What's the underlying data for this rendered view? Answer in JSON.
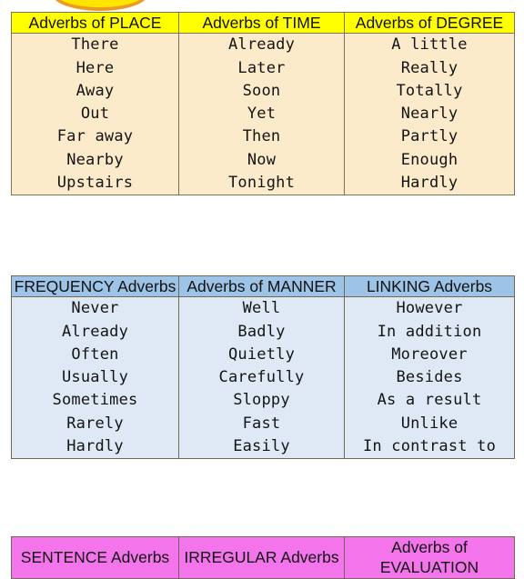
{
  "page": {
    "title": "Adverbs Categories Chart",
    "background_color": "#ffffff"
  },
  "decoration": {
    "badge_name": "partial-oval-badge",
    "fill_color": "#FFE600",
    "border_color": "#ED9B20"
  },
  "tables": [
    {
      "id": "place-time-degree",
      "header_color": "#FFFF00",
      "body_color": "#FCEBCA",
      "columns": [
        {
          "header": "Adverbs of PLACE",
          "items": [
            "There",
            "Here",
            "Away",
            "Out",
            "Far away",
            "Nearby",
            "Upstairs"
          ]
        },
        {
          "header": "Adverbs of TIME",
          "items": [
            "Already",
            "Later",
            "Soon",
            "Yet",
            "Then",
            "Now",
            "Tonight"
          ]
        },
        {
          "header": "Adverbs of DEGREE",
          "items": [
            "A little",
            "Really",
            "Totally",
            "Nearly",
            "Partly",
            "Enough",
            "Hardly"
          ]
        }
      ]
    },
    {
      "id": "frequency-manner-linking",
      "header_color": "#9DC3E6",
      "body_color": "#DEE9F5",
      "columns": [
        {
          "header": "FREQUENCY Adverbs",
          "items": [
            "Never",
            "Already",
            "Often",
            "Usually",
            "Sometimes",
            "Rarely",
            "Hardly"
          ]
        },
        {
          "header": "Adverbs of MANNER",
          "items": [
            "Well",
            "Badly",
            "Quietly",
            "Carefully",
            "Sloppy",
            "Fast",
            "Easily"
          ]
        },
        {
          "header": "LINKING Adverbs",
          "items": [
            "However",
            "In addition",
            "Moreover",
            "Besides",
            "As a result",
            "Unlike",
            "In contrast to"
          ]
        }
      ]
    },
    {
      "id": "sentence-irregular-evaluation",
      "header_color": "#F474EC",
      "body_color": "#FBD9F7",
      "columns": [
        {
          "header": "SENTENCE Adverbs",
          "items": []
        },
        {
          "header": "IRREGULAR Adverbs",
          "items": []
        },
        {
          "header": "Adverbs of EVALUATION",
          "items": []
        }
      ]
    }
  ]
}
